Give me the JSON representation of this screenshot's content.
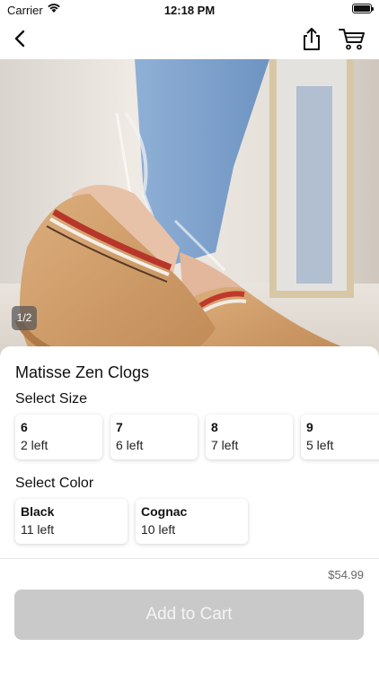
{
  "status_bar": {
    "carrier": "Carrier",
    "time": "12:18 PM"
  },
  "nav": {
    "back_icon": "chevron-left-icon",
    "share_icon": "share-icon",
    "cart_icon": "cart-icon"
  },
  "gallery": {
    "page_indicator": "1/2"
  },
  "product": {
    "title": "Matisse Zen Clogs",
    "price": "$54.99"
  },
  "size_section": {
    "label": "Select Size",
    "options": [
      {
        "size": "6",
        "stock": "2 left"
      },
      {
        "size": "7",
        "stock": "6 left"
      },
      {
        "size": "8",
        "stock": "7 left"
      },
      {
        "size": "9",
        "stock": "5 left"
      }
    ]
  },
  "color_section": {
    "label": "Select Color",
    "options": [
      {
        "color": "Black",
        "stock": "11 left"
      },
      {
        "color": "Cognac",
        "stock": "10 left"
      }
    ]
  },
  "footer": {
    "add_to_cart_label": "Add to Cart",
    "button_color": "#c9c9c9"
  }
}
